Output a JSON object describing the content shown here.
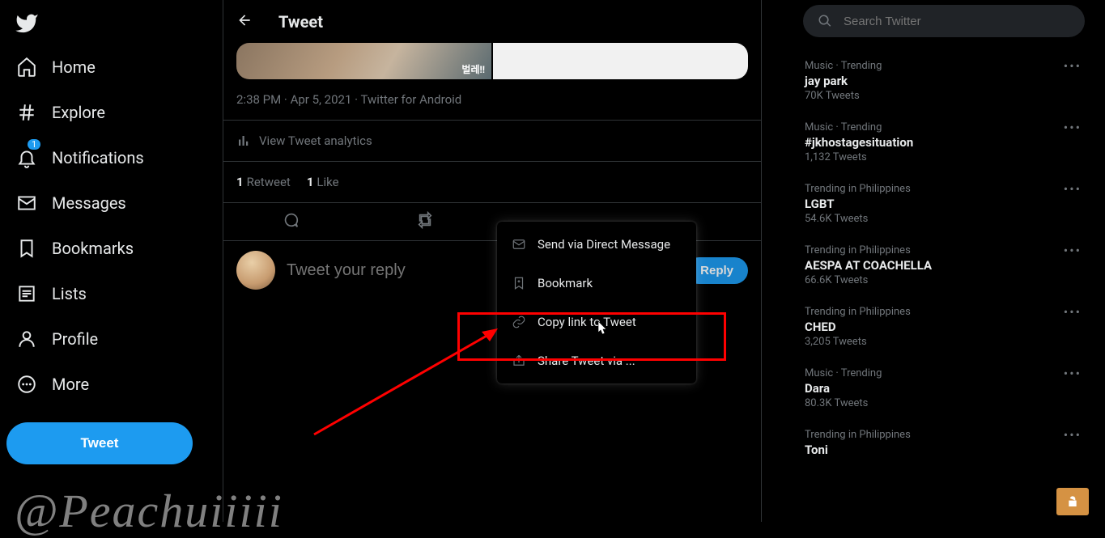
{
  "header": {
    "title": "Tweet"
  },
  "sidebar": {
    "items": [
      {
        "label": "Home"
      },
      {
        "label": "Explore"
      },
      {
        "label": "Notifications",
        "badge": "1"
      },
      {
        "label": "Messages"
      },
      {
        "label": "Bookmarks"
      },
      {
        "label": "Lists"
      },
      {
        "label": "Profile"
      },
      {
        "label": "More"
      }
    ],
    "tweet_button": "Tweet"
  },
  "tweet": {
    "media_caption": "벌레!!",
    "timestamp": "2:38 PM · Apr 5, 2021",
    "source": "Twitter for Android",
    "analytics_label": "View Tweet analytics",
    "retweet_count": "1",
    "retweet_label": "Retweet",
    "like_count": "1",
    "like_label": "Like"
  },
  "reply": {
    "placeholder": "Tweet your reply",
    "button": "Reply"
  },
  "share_menu": {
    "dm": "Send via Direct Message",
    "bookmark": "Bookmark",
    "copy_link": "Copy link to Tweet",
    "share_via": "Share Tweet via ..."
  },
  "search": {
    "placeholder": "Search Twitter"
  },
  "trends": [
    {
      "meta": "Music · Trending",
      "title": "jay park",
      "count": "70K Tweets"
    },
    {
      "meta": "Music · Trending",
      "title": "#jkhostagesituation",
      "count": "1,132 Tweets"
    },
    {
      "meta": "Trending in Philippines",
      "title": "LGBT",
      "count": "54.6K Tweets"
    },
    {
      "meta": "Trending in Philippines",
      "title": "AESPA AT COACHELLA",
      "count": "66.6K Tweets"
    },
    {
      "meta": "Trending in Philippines",
      "title": "CHED",
      "count": "3,205 Tweets"
    },
    {
      "meta": "Music · Trending",
      "title": "Dara",
      "count": "80.3K Tweets"
    },
    {
      "meta": "Trending in Philippines",
      "title": "Toni",
      "count": ""
    }
  ],
  "watermark": "@Peachuiiiii"
}
